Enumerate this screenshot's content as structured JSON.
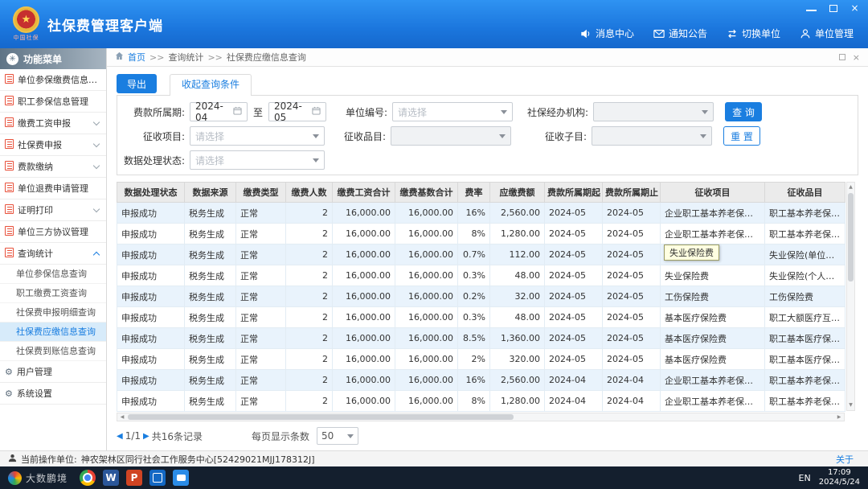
{
  "titlebar": {
    "title": "社保费管理客户端",
    "logo_caption": "中国社保",
    "actions": [
      {
        "icon": "speaker-icon",
        "label": "消息中心"
      },
      {
        "icon": "mail-icon",
        "label": "通知公告"
      },
      {
        "icon": "switch-icon",
        "label": "切换单位"
      },
      {
        "icon": "unit-icon",
        "label": "单位管理"
      }
    ]
  },
  "sidebar": {
    "header": "功能菜单",
    "items": [
      {
        "icon": "doc-icon",
        "label": "单位参保缴费信息管理"
      },
      {
        "icon": "doc-icon",
        "label": "职工参保信息管理"
      },
      {
        "icon": "doc-icon",
        "label": "缴费工资申报",
        "chevron": "down"
      },
      {
        "icon": "doc-icon",
        "label": "社保费申报",
        "chevron": "down"
      },
      {
        "icon": "doc-icon",
        "label": "费款缴纳",
        "chevron": "down"
      },
      {
        "icon": "doc-icon",
        "label": "单位退费申请管理"
      },
      {
        "icon": "doc-icon",
        "label": "证明打印",
        "chevron": "down"
      },
      {
        "icon": "doc-icon",
        "label": "单位三方协议管理"
      },
      {
        "icon": "doc-icon",
        "label": "查询统计",
        "chevron": "up",
        "children": [
          {
            "label": "单位参保信息查询"
          },
          {
            "label": "职工缴费工资查询"
          },
          {
            "label": "社保费申报明细查询"
          },
          {
            "label": "社保费应缴信息查询",
            "active": true
          },
          {
            "label": "社保费到账信息查询"
          }
        ]
      },
      {
        "icon": "gear-icon",
        "label": "用户管理"
      },
      {
        "icon": "gear-icon",
        "label": "系统设置"
      }
    ]
  },
  "breadcrumb": {
    "home": "首页",
    "separator": ">>",
    "items": [
      "查询统计",
      "社保费应缴信息查询"
    ]
  },
  "toolbar": {
    "export_label": "导出",
    "collapse_tab": "收起查询条件"
  },
  "filters": {
    "period_label": "费款所属期:",
    "period_from": "2024-04",
    "to_label": "至",
    "period_to": "2024-05",
    "unit_no_label": "单位编号:",
    "unit_no_placeholder": "请选择",
    "agency_label": "社保经办机构:",
    "agency_value": "",
    "project_label": "征收项目:",
    "project_placeholder": "请选择",
    "item_label": "征收品目:",
    "item_value": "",
    "subitem_label": "征收子目:",
    "subitem_value": "",
    "status_label": "数据处理状态:",
    "status_placeholder": "请选择",
    "search_label": "查 询",
    "reset_label": "重 置"
  },
  "table": {
    "headers": [
      "数据处理状态",
      "数据来源",
      "缴费类型",
      "缴费人数",
      "缴费工资合计",
      "缴费基数合计",
      "费率",
      "应缴费额",
      "费款所属期起",
      "费款所属期止",
      "征收项目",
      "征收品目"
    ],
    "rows": [
      [
        "申报成功",
        "税务生成",
        "正常",
        "2",
        "16,000.00",
        "16,000.00",
        "16%",
        "2,560.00",
        "2024-05",
        "2024-05",
        "企业职工基本养老保险费",
        "职工基本养老保险(单位…"
      ],
      [
        "申报成功",
        "税务生成",
        "正常",
        "2",
        "16,000.00",
        "16,000.00",
        "8%",
        "1,280.00",
        "2024-05",
        "2024-05",
        "企业职工基本养老保险费",
        "职工基本养老保险(个人…"
      ],
      [
        "申报成功",
        "税务生成",
        "正常",
        "2",
        "16,000.00",
        "16,000.00",
        "0.7%",
        "112.00",
        "2024-05",
        "2024-05",
        "失业保险费",
        "失业保险(单位缴纳)"
      ],
      [
        "申报成功",
        "税务生成",
        "正常",
        "2",
        "16,000.00",
        "16,000.00",
        "0.3%",
        "48.00",
        "2024-05",
        "2024-05",
        "失业保险费",
        "失业保险(个人缴纳)"
      ],
      [
        "申报成功",
        "税务生成",
        "正常",
        "2",
        "16,000.00",
        "16,000.00",
        "0.2%",
        "32.00",
        "2024-05",
        "2024-05",
        "工伤保险费",
        "工伤保险费"
      ],
      [
        "申报成功",
        "税务生成",
        "正常",
        "2",
        "16,000.00",
        "16,000.00",
        "0.3%",
        "48.00",
        "2024-05",
        "2024-05",
        "基本医疗保险费",
        "职工大额医疗互助保险(…"
      ],
      [
        "申报成功",
        "税务生成",
        "正常",
        "2",
        "16,000.00",
        "16,000.00",
        "8.5%",
        "1,360.00",
        "2024-05",
        "2024-05",
        "基本医疗保险费",
        "职工基本医疗保险(单位…"
      ],
      [
        "申报成功",
        "税务生成",
        "正常",
        "2",
        "16,000.00",
        "16,000.00",
        "2%",
        "320.00",
        "2024-05",
        "2024-05",
        "基本医疗保险费",
        "职工基本医疗保险(个人…"
      ],
      [
        "申报成功",
        "税务生成",
        "正常",
        "2",
        "16,000.00",
        "16,000.00",
        "16%",
        "2,560.00",
        "2024-04",
        "2024-04",
        "企业职工基本养老保险费",
        "职工基本养老保险(单位…"
      ],
      [
        "申报成功",
        "税务生成",
        "正常",
        "2",
        "16,000.00",
        "16,000.00",
        "8%",
        "1,280.00",
        "2024-04",
        "2024-04",
        "企业职工基本养老保险费",
        "职工基本养老保险(个人…"
      ]
    ]
  },
  "tooltip": {
    "text": "失业保险费"
  },
  "pagination": {
    "prev": "◀",
    "page": "1/1",
    "next": "▶",
    "total": "共16条记录",
    "page_size_label": "每页显示条数",
    "page_size": "50"
  },
  "statusbar": {
    "operator_label": "当前操作单位:",
    "operator_value": "神农架林区同行社会工作服务中心[52429021MJJ178312J]",
    "about": "关于"
  },
  "taskbar": {
    "brand": "大数鹏境",
    "icons": [
      "chrome-icon",
      "word-icon",
      "powerpoint-icon",
      "tax-app-icon",
      "chat-app-icon"
    ],
    "lang": "EN",
    "time": "17:09",
    "date": "2024/5/24"
  }
}
